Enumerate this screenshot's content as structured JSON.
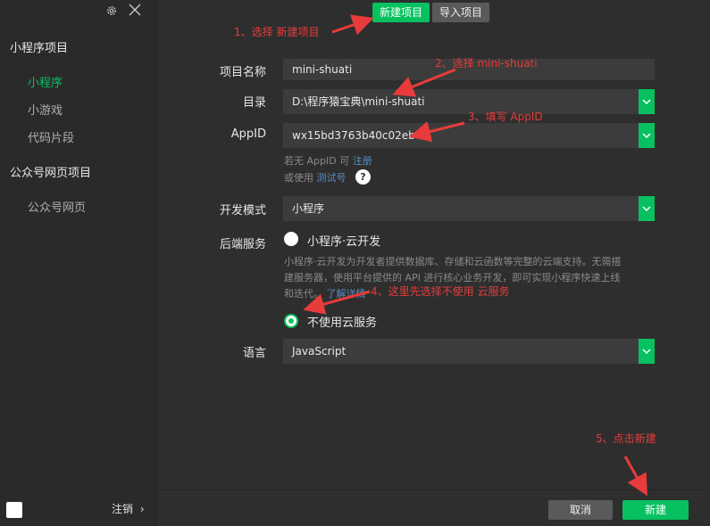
{
  "sidebar": {
    "section_miniprogram": "小程序项目",
    "items_miniprogram": [
      "小程序",
      "小游戏",
      "代码片段"
    ],
    "section_official": "公众号网页项目",
    "items_official": [
      "公众号网页"
    ],
    "logout_label": "注销",
    "logout_arrow": "›"
  },
  "top_tabs": {
    "new_project": "新建项目",
    "import_project": "导入项目"
  },
  "form": {
    "project_name_label": "项目名称",
    "project_name_value": "mini-shuati",
    "directory_label": "目录",
    "directory_value": "D:\\程序猿宝典\\mini-shuati",
    "appid_label": "AppID",
    "appid_value": "wx15bd3763b40c02eb",
    "appid_hint_prefix": "若无 AppID 可",
    "appid_hint_link": "注册",
    "testid_hint_prefix": "或使用",
    "testid_hint_link": "测试号",
    "help_symbol": "?",
    "dev_mode_label": "开发模式",
    "dev_mode_value": "小程序",
    "backend_label": "后端服务",
    "backend_option_cloud": "小程序·云开发",
    "backend_desc_line1": "小程序·云开发为开发者提供数据库、存储和云函数等完整的云端支持。无需搭",
    "backend_desc_line2": "建服务器，使用平台提供的 API 进行核心业务开发，即可实现小程序快速上线",
    "backend_desc_line3": "和迭代。",
    "backend_desc_link": "了解详情",
    "backend_option_none": "不使用云服务",
    "language_label": "语言",
    "language_value": "JavaScript"
  },
  "footer": {
    "cancel_label": "取消",
    "create_label": "新建"
  },
  "annotations": {
    "step1": "1、选择 新建项目",
    "step2": "2、选择 mini-shuati",
    "step3": "3、填写 AppID",
    "step4": "4、这里先选择不使用 云服务",
    "step5": "5、点击新建"
  },
  "colors": {
    "accent": "#07c160",
    "annotation": "#e83b3b",
    "link": "#5b8cc0"
  },
  "icons": [
    "gear-icon",
    "close-icon",
    "chevron-down-icon",
    "help-icon",
    "checkbox-icon"
  ]
}
